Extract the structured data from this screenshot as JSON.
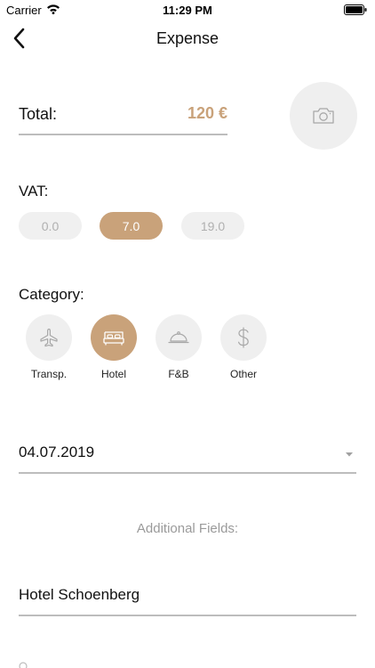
{
  "status_bar": {
    "carrier": "Carrier",
    "time": "11:29 PM",
    "icons": [
      "wifi-icon",
      "battery-icon"
    ]
  },
  "nav": {
    "title": "Expense",
    "back_icon": "chevron-left-icon"
  },
  "total": {
    "label": "Total:",
    "value": "120 €",
    "camera_icon": "camera-icon"
  },
  "vat": {
    "label": "VAT:",
    "options": [
      "0.0",
      "7.0",
      "19.0"
    ],
    "selected": "7.0"
  },
  "category": {
    "label": "Category:",
    "items": [
      {
        "label": "Transp.",
        "icon": "airplane-icon"
      },
      {
        "label": "Hotel",
        "icon": "bed-icon"
      },
      {
        "label": "F&B",
        "icon": "cloche-icon"
      },
      {
        "label": "Other",
        "icon": "dollar-icon"
      }
    ],
    "selected": "Hotel"
  },
  "date": {
    "value": "04.07.2019",
    "dropdown_icon": "caret-down-icon"
  },
  "additional": {
    "heading": "Additional Fields:",
    "hotel_name": "Hotel Schoenberg"
  },
  "colors": {
    "accent": "#c9a27a",
    "pill_bg": "#f0f0f0",
    "circle_bg": "#efefef",
    "muted_text": "#9a9a9a",
    "underline": "#bdbdbd"
  }
}
